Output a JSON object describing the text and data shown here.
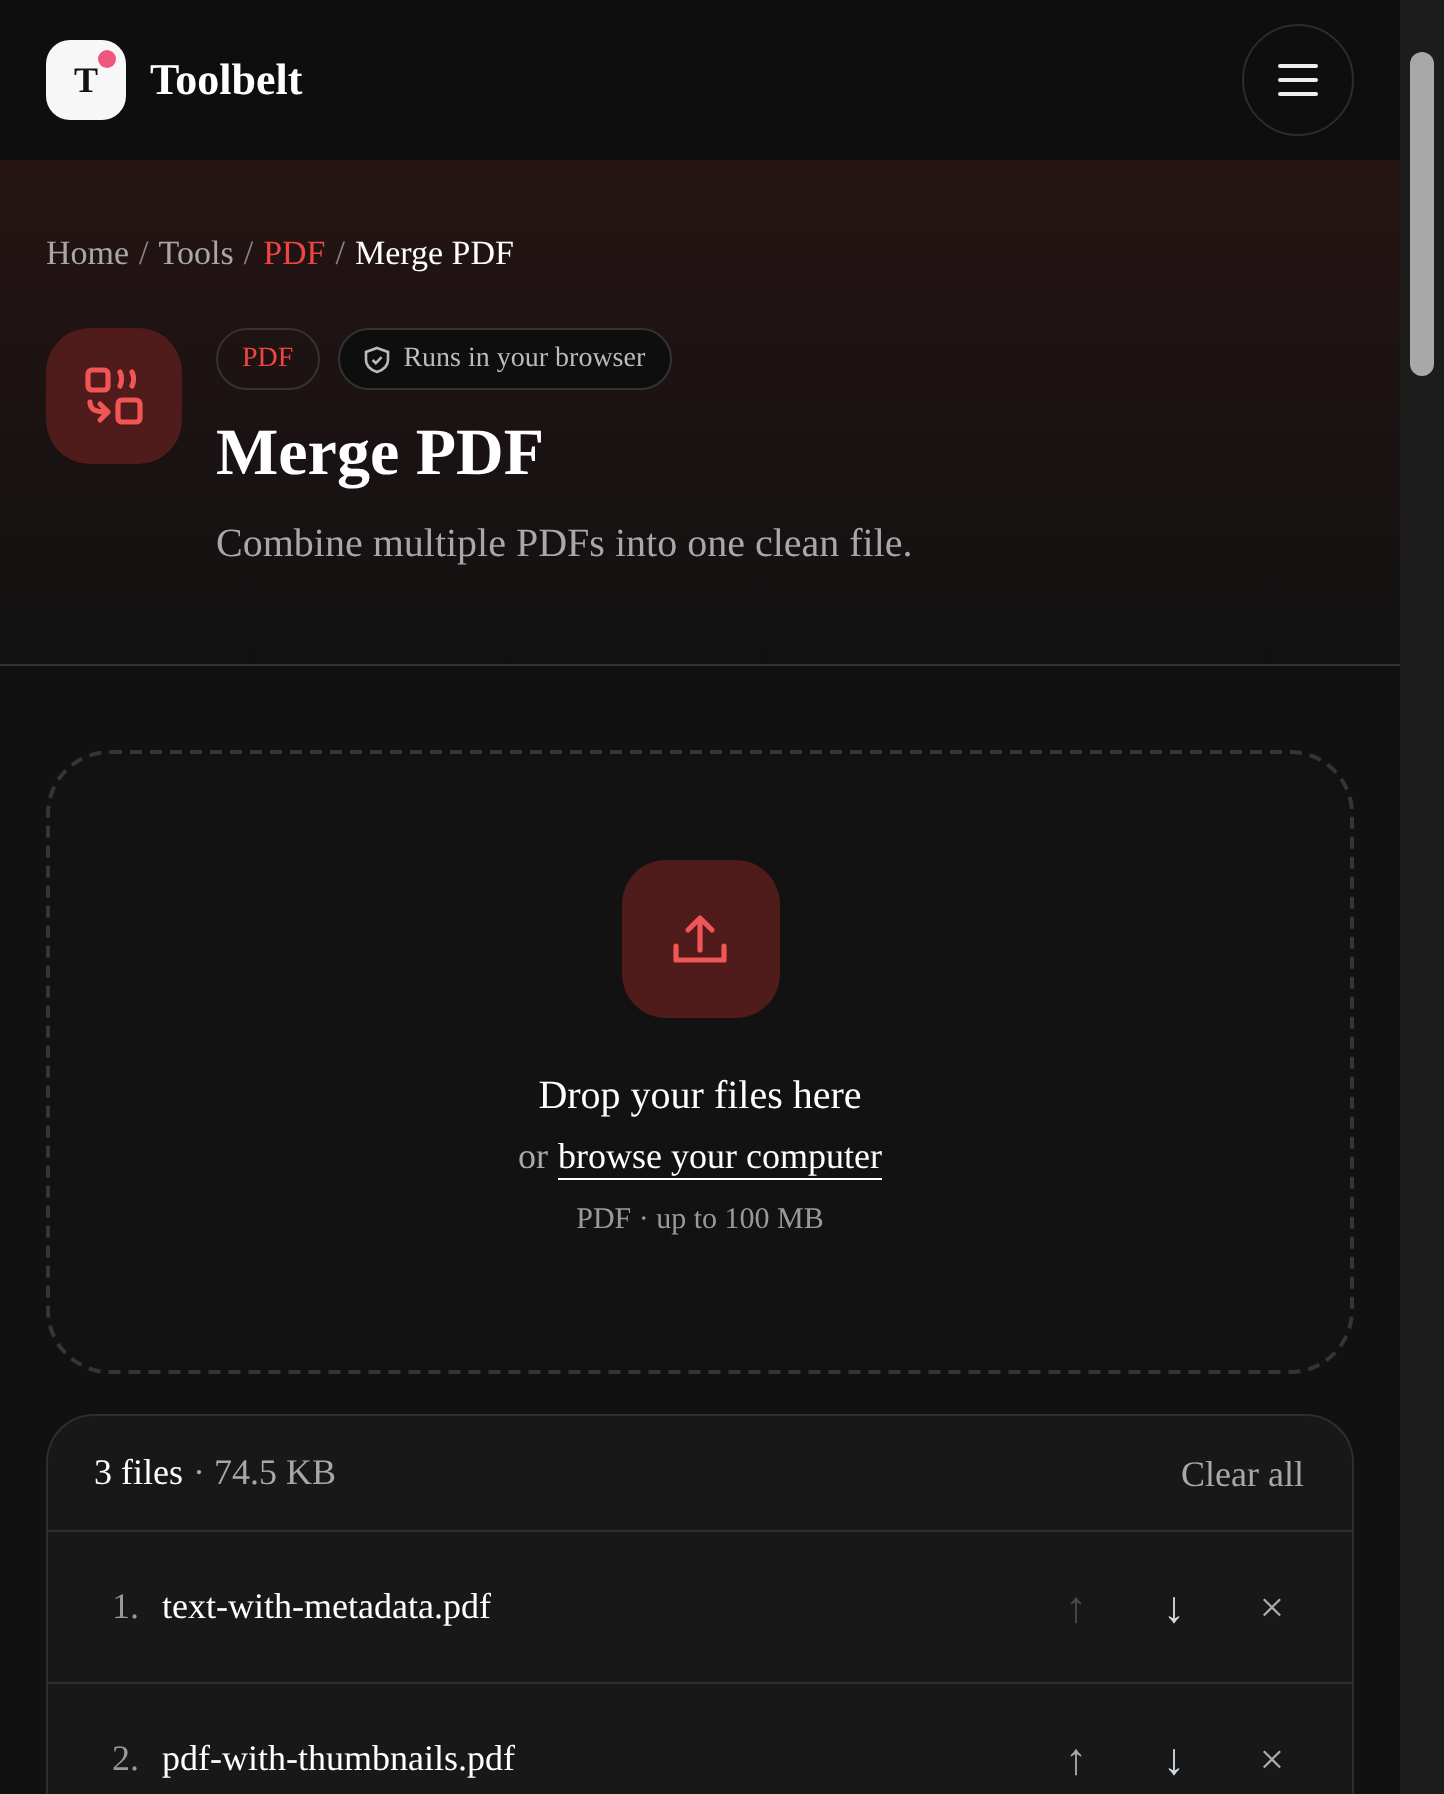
{
  "header": {
    "logo_letter": "T",
    "brand": "Toolbelt"
  },
  "breadcrumb": [
    {
      "label": "Home",
      "kind": "link"
    },
    {
      "label": "/",
      "kind": "separator"
    },
    {
      "label": "Tools",
      "kind": "link"
    },
    {
      "label": "/",
      "kind": "separator"
    },
    {
      "label": "PDF",
      "kind": "category"
    },
    {
      "label": "/",
      "kind": "separator"
    },
    {
      "label": "Merge PDF",
      "kind": "current"
    }
  ],
  "badges": [
    {
      "label": "PDF",
      "kind": "category"
    },
    {
      "label": "Runs in your browser",
      "kind": "info"
    }
  ],
  "title": "Merge PDF",
  "subtitle": "Combine multiple PDFs into one clean file.",
  "dropzone": {
    "heading": "Drop your files here",
    "prefix": "or",
    "link": "browse your computer",
    "hint": "PDF · up to 100 MB"
  },
  "files": {
    "count": "3 files",
    "size": "· 74.5 KB",
    "clear": "Clear all",
    "rows": [
      {
        "number": "1.",
        "name": "text-with-metadata.pdf",
        "actions": [
          {
            "kind": "up",
            "symbol": "↑",
            "disabled": true
          },
          {
            "kind": "down",
            "symbol": "↓",
            "disabled": false
          },
          {
            "kind": "remove",
            "symbol": "×",
            "disabled": false
          }
        ]
      },
      {
        "number": "2.",
        "name": "pdf-with-thumbnails.pdf",
        "actions": [
          {
            "kind": "up",
            "symbol": "↑",
            "disabled": false
          },
          {
            "kind": "down",
            "symbol": "↓",
            "disabled": false
          },
          {
            "kind": "remove",
            "symbol": "×",
            "disabled": false
          }
        ]
      }
    ]
  }
}
